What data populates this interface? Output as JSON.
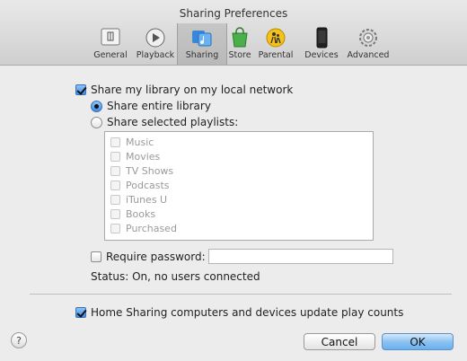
{
  "window": {
    "title": "Sharing Preferences"
  },
  "toolbar": {
    "items": [
      {
        "label": "General",
        "icon": "general-icon"
      },
      {
        "label": "Playback",
        "icon": "playback-icon"
      },
      {
        "label": "Sharing",
        "icon": "sharing-icon",
        "selected": true
      },
      {
        "label": "Store",
        "icon": "store-icon"
      },
      {
        "label": "Parental",
        "icon": "parental-icon"
      },
      {
        "label": "Devices",
        "icon": "devices-icon"
      },
      {
        "label": "Advanced",
        "icon": "advanced-icon"
      }
    ]
  },
  "sharing": {
    "share_library": {
      "label": "Share my library on my local network",
      "checked": true
    },
    "share_entire": {
      "label": "Share entire library",
      "selected": true
    },
    "share_selected": {
      "label": "Share selected playlists:",
      "selected": false
    },
    "playlists": [
      "Music",
      "Movies",
      "TV Shows",
      "Podcasts",
      "iTunes U",
      "Books",
      "Purchased"
    ],
    "require_password": {
      "label": "Require password:",
      "checked": false,
      "value": ""
    },
    "status": "Status: On, no users connected",
    "home_sharing": {
      "label": "Home Sharing computers and devices update play counts",
      "checked": true
    }
  },
  "footer": {
    "help_label": "?",
    "cancel_label": "Cancel",
    "ok_label": "OK"
  },
  "colors": {
    "accent": "#3e8ee6",
    "ok_button": "#6ab0ee"
  }
}
